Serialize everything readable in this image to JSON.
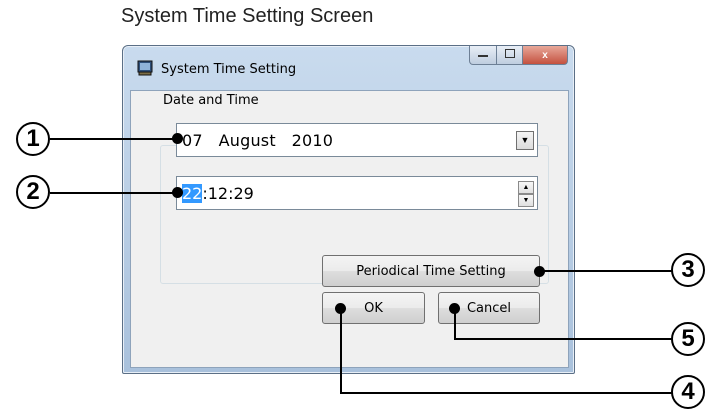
{
  "caption": "System Time Setting Screen",
  "window": {
    "title": "System Time Setting",
    "icon": "app-window-icon",
    "controls": {
      "minimize": "minimize-icon",
      "maximize": "maximize-icon",
      "close": "x"
    }
  },
  "group": {
    "label": "Date and Time"
  },
  "date": {
    "value": "07   August   2010",
    "dropdown_icon": "▼"
  },
  "time": {
    "hour": "22",
    "rest": ":12:29",
    "spin_up": "▲",
    "spin_down": "▼"
  },
  "buttons": {
    "periodical": "Periodical Time Setting",
    "ok": "OK",
    "cancel": "Cancel"
  },
  "callouts": {
    "c1": "1",
    "c2": "2",
    "c3": "3",
    "c4": "4",
    "c5": "5"
  }
}
